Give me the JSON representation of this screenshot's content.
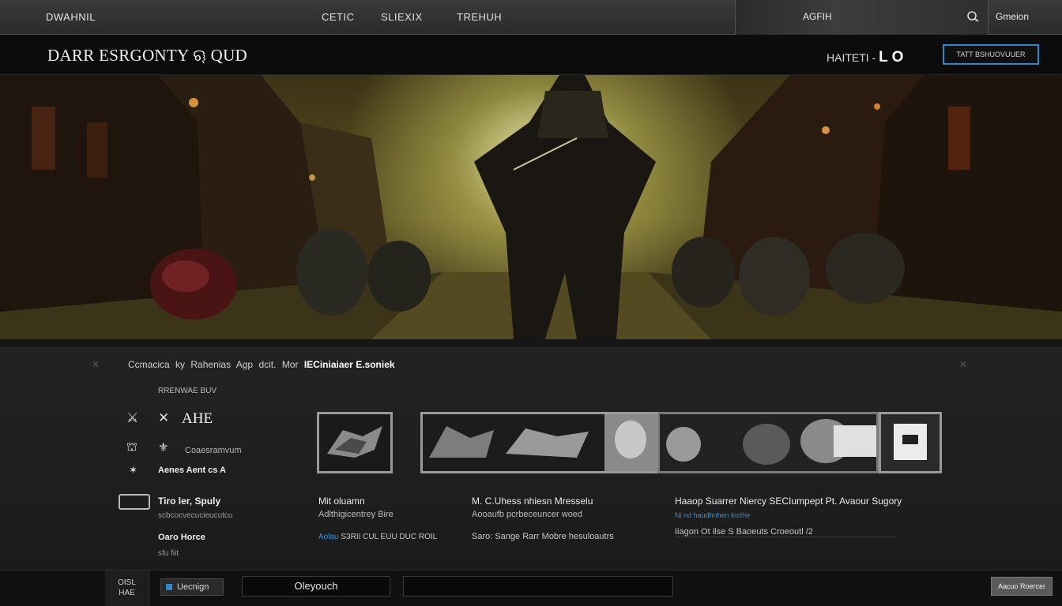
{
  "top_nav": {
    "brand": "DWAHNIL",
    "links": [
      "CETIC",
      "SLIEXIX",
      "TREHUH"
    ],
    "account": "AGFIH",
    "signin": "Gmeion"
  },
  "header": {
    "logo": "DARR ESRGONTY",
    "logo_suffix": "ୠ QUD",
    "count_label": "HAITETI -",
    "count_value": "L O",
    "cta_label": "TATT BSHUOVUUER"
  },
  "breadcrumb": {
    "items": [
      "Ccmacica",
      "ky",
      "Rahenias",
      "Agp",
      "dcit.",
      "Mor"
    ],
    "current": "IECiniaiaer E.soniek"
  },
  "sidebar": {
    "sub_label": "RRENWAE BUV",
    "title": "AHE",
    "row1_text": "Coaesramvum",
    "row2_text": "Aenes Aent cs A",
    "section1_title": "Tiro ler, Spuly",
    "section1_sub": "scbcocvecucieucutcu",
    "section2_title": "Oaro Horce",
    "section2_sub": "sfu fiit"
  },
  "items": [
    {
      "title": "Mit oluamn",
      "sub": "Adlthigicentrey Bire",
      "meta_prefix": "Aolau",
      "meta": "S3RII CUL EUU DUC ROIL"
    },
    {
      "title": "M. C.Uhess nhiesn Mresselu",
      "sub": "Aooaufb pcrbeceuncer woed",
      "meta": "Saro:  Sange Rarr  Mobre  hesuloautrs"
    },
    {
      "title": "Haaop Suarrer Niercy SECIumpept Pt. Avaour Sugory",
      "sub": "Ni nd haudhnhen lncthe",
      "meta": "Iiagon Ot ilse S Baoeuts Croeoutl /2"
    }
  ],
  "bottom_bar": {
    "page_label": "OISL",
    "page_num": "HAE",
    "language": "Uecnign",
    "dropdown_value": "Oleyouch",
    "corner_button": "Aacuo Roercer"
  }
}
